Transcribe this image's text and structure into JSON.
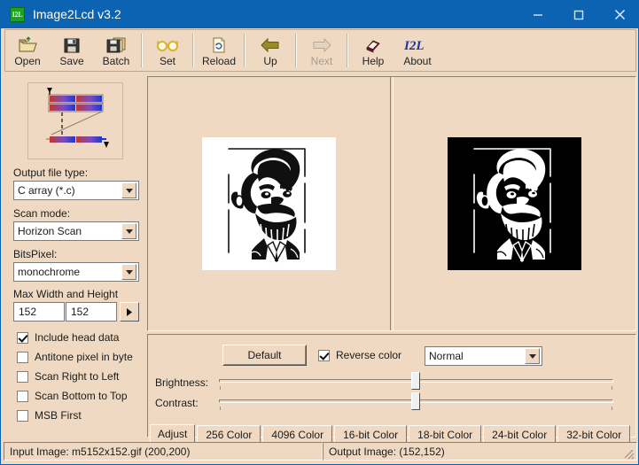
{
  "window": {
    "title": "Image2Lcd v3.2",
    "icon_label": "I2L",
    "controls": [
      {
        "name": "minimize-button",
        "glyph": "minimize-icon"
      },
      {
        "name": "maximize-button",
        "glyph": "maximize-icon"
      },
      {
        "name": "close-button",
        "glyph": "close-icon"
      }
    ]
  },
  "toolbar": {
    "items": [
      {
        "label": "Open",
        "icon": "open-folder-icon",
        "disabled": false
      },
      {
        "label": "Save",
        "icon": "floppy-disk-icon",
        "disabled": false
      },
      {
        "label": "Batch",
        "icon": "stacked-disks-icon",
        "disabled": false
      },
      {
        "label": "Set",
        "icon": "glasses-icon",
        "disabled": false
      },
      {
        "label": "Reload",
        "icon": "refresh-page-icon",
        "disabled": false
      },
      {
        "label": "Up",
        "icon": "arrow-left-icon",
        "disabled": false
      },
      {
        "label": "Next",
        "icon": "arrow-right-icon",
        "disabled": true
      },
      {
        "label": "Help",
        "icon": "book-icon",
        "disabled": false
      },
      {
        "label": "About",
        "icon": "i2l-logo-icon",
        "disabled": false
      }
    ]
  },
  "sidebar": {
    "logo_alt": "scan-pattern-logo",
    "output_file_type": {
      "label": "Output file type:",
      "value": "C array (*.c)"
    },
    "scan_mode": {
      "label": "Scan mode:",
      "value": "Horizon Scan"
    },
    "bits_pixel": {
      "label": "BitsPixel:",
      "value": "monochrome"
    },
    "max_size": {
      "label": "Max Width and Height",
      "width": "152",
      "height": "152"
    },
    "checkboxes": [
      {
        "label": "Include head data",
        "checked": true
      },
      {
        "label": "Antitone pixel in byte",
        "checked": false
      },
      {
        "label": "Scan Right to Left",
        "checked": false
      },
      {
        "label": "Scan Bottom to Top",
        "checked": false
      },
      {
        "label": "MSB First",
        "checked": false
      }
    ]
  },
  "preview": {
    "source_image_alt": "caricature-portrait-source",
    "output_image_alt": "caricature-portrait-inverted"
  },
  "adjust_panel": {
    "default_button": "Default",
    "reverse_color": {
      "label": "Reverse color",
      "checked": true
    },
    "mode_select": {
      "value": "Normal"
    },
    "brightness": {
      "label": "Brightness:",
      "value": 50
    },
    "contrast": {
      "label": "Contrast:",
      "value": 50
    }
  },
  "tabs": {
    "active": "Adjust",
    "items": [
      "Adjust",
      "256 Color",
      "4096 Color",
      "16-bit Color",
      "18-bit Color",
      "24-bit Color",
      "32-bit Color"
    ]
  },
  "statusbar": {
    "input": "Input Image: m5152x152.gif (200,200)",
    "output": "Output Image: (152,152)"
  },
  "colors": {
    "titlebar": "#0B63B2",
    "background": "#EFD9C2",
    "text": "#1b1b1b",
    "accent_green": "#18a321"
  }
}
